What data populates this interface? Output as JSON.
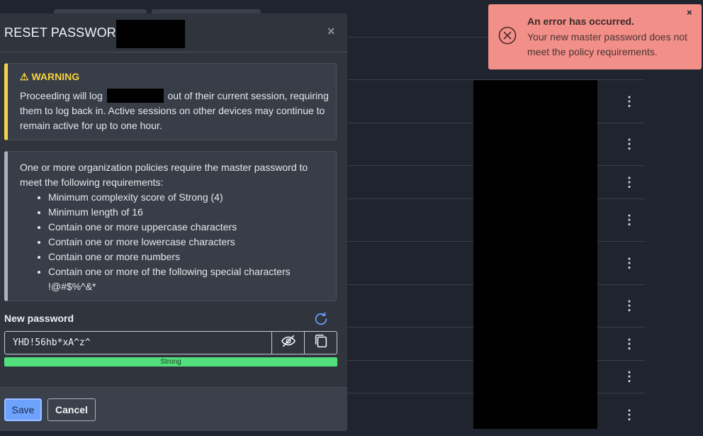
{
  "modal": {
    "title": "RESET PASSWORD",
    "close_glyph": "×",
    "warning": {
      "title": "⚠ WARNING",
      "text_before": "Proceeding will log",
      "text_after": "out of their current session, requiring them to log back in. Active sessions on other devices may continue to remain active for up to one hour."
    },
    "policy": {
      "intro": "One or more organization policies require the master password to meet the following requirements:",
      "requirements": [
        "Minimum complexity score of Strong (4)",
        "Minimum length of 16",
        "Contain one or more uppercase characters",
        "Contain one or more lowercase characters",
        "Contain one or more numbers",
        "Contain one or more of the following special characters !@#$%^&*"
      ]
    },
    "new_password": {
      "label": "New password",
      "value": "YHD!56hb*xA^z^"
    },
    "strength": {
      "label": "Strong",
      "level": 1.0,
      "color": "#52e07c"
    },
    "footer": {
      "save_label": "Save",
      "cancel_label": "Cancel"
    }
  },
  "toast": {
    "title": "An error has occurred.",
    "message": "Your new master password does not meet the policy requirements.",
    "close_glyph": "×",
    "color": "#f28f88"
  },
  "background": {
    "row_menu_glyph": "⋮"
  },
  "icons": {
    "toast_icon": "error-circle-x-icon",
    "regenerate": "refresh-icon",
    "toggle_visibility": "eye-slash-icon",
    "copy": "copy-icon"
  },
  "colors": {
    "accent": "#6ea2ff",
    "warning": "#f0d54a"
  }
}
